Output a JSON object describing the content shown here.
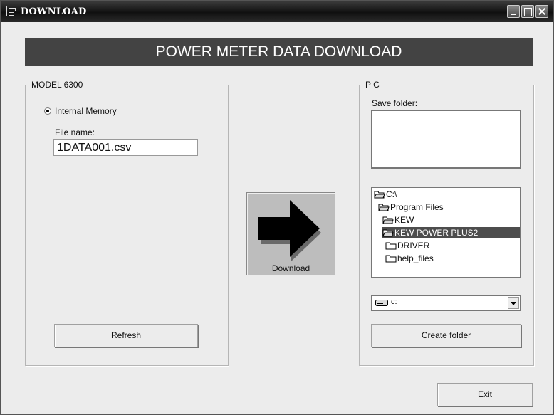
{
  "window": {
    "title": "DOWNLOAD",
    "controls": [
      "minimize",
      "maximize",
      "close"
    ]
  },
  "banner": {
    "title": "POWER METER DATA DOWNLOAD"
  },
  "model_group": {
    "legend": "MODEL 6300",
    "radio_label": "Internal Memory",
    "radio_selected": true,
    "file_name_label": "File name:",
    "file_name_value": "1DATA001.csv",
    "refresh_label": "Refresh"
  },
  "download": {
    "label": "Download",
    "icon": "arrow-right-icon"
  },
  "pc_group": {
    "legend": "P C",
    "save_folder_label": "Save folder:",
    "save_folder_value": "",
    "tree": [
      {
        "label": "C:\\",
        "icon": "open-folder-icon",
        "selected": false
      },
      {
        "label": "Program Files",
        "icon": "open-folder-icon",
        "selected": false
      },
      {
        "label": "KEW",
        "icon": "open-folder-icon",
        "selected": false
      },
      {
        "label": "KEW POWER PLUS2",
        "icon": "open-folder-icon",
        "selected": true
      },
      {
        "label": "DRIVER",
        "icon": "folder-icon",
        "selected": false
      },
      {
        "label": "help_files",
        "icon": "folder-icon",
        "selected": false
      }
    ],
    "drive_value": "c:",
    "create_folder_label": "Create folder"
  },
  "exit_label": "Exit",
  "colors": {
    "titlebar": "#1a1a1a",
    "banner": "#434343",
    "background": "#ececec",
    "selection": "#4d4d4d"
  }
}
